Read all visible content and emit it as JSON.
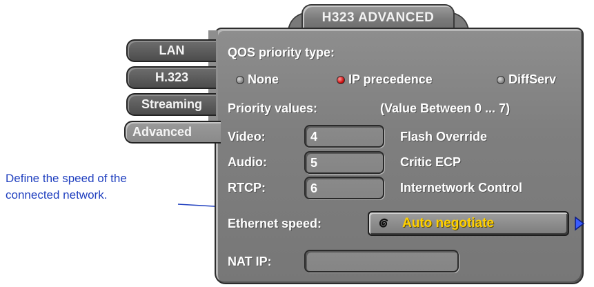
{
  "callout": {
    "line1": "Define the speed of the",
    "line2": "connected network."
  },
  "window": {
    "title": "H323 ADVANCED"
  },
  "tabs": [
    {
      "label": "LAN",
      "active": false
    },
    {
      "label": "H.323",
      "active": false
    },
    {
      "label": "Streaming",
      "active": false
    },
    {
      "label": "Advanced",
      "active": true
    }
  ],
  "qos": {
    "heading": "QOS priority type:",
    "options": [
      {
        "label": "None",
        "selected": false
      },
      {
        "label": "IP precedence",
        "selected": true
      },
      {
        "label": "DiffServ",
        "selected": false
      }
    ]
  },
  "priority": {
    "heading": "Priority values:",
    "range_note": "(Value Between 0 ... 7)",
    "rows": [
      {
        "label": "Video:",
        "value": "4",
        "meaning": "Flash Override"
      },
      {
        "label": "Audio:",
        "value": "5",
        "meaning": "Critic ECP"
      },
      {
        "label": "RTCP:",
        "value": "6",
        "meaning": "Internetwork Control"
      }
    ]
  },
  "ethernet": {
    "label": "Ethernet speed:",
    "value": "Auto negotiate",
    "icon": "spiral-icon"
  },
  "nat": {
    "label": "NAT IP:",
    "value": ""
  },
  "colors": {
    "callout_text": "#1f3fbf",
    "dropdown_value": "#ffd000",
    "radio_selected": "#d01010",
    "panel": "#808080"
  }
}
